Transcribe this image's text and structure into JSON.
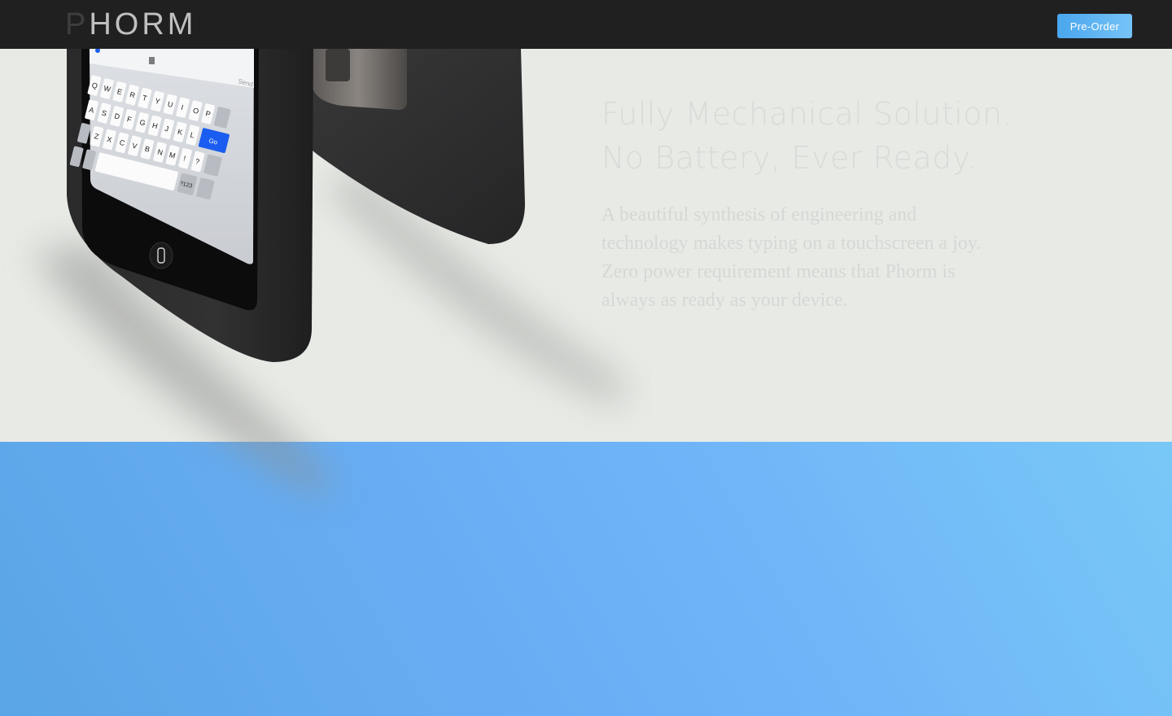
{
  "nav": {
    "logo_first": "P",
    "logo_rest": "HORM",
    "preorder_label": "Pre-Order"
  },
  "hero": {
    "headline_line1": "Fully Mechanical Solution.",
    "headline_line2": "No Battery, Ever Ready.",
    "body": "A beautiful synthesis of engineering and technology makes typing on a touchscreen a joy. Zero power requirement means that Phorm is always as ready as your device."
  },
  "keyboard": {
    "row1": [
      "Q",
      "W",
      "E",
      "R",
      "T",
      "Y",
      "U",
      "I",
      "O",
      "P"
    ],
    "row2": [
      "A",
      "S",
      "D",
      "F",
      "G",
      "H",
      "J",
      "K",
      "L"
    ],
    "row3": [
      "Z",
      "X",
      "C",
      "V",
      "B",
      "N",
      "M",
      "!",
      "?"
    ],
    "send_label": "Send",
    "go_label": "Go",
    "numbers_label": "?123"
  },
  "colors": {
    "nav_bg": "#212021",
    "hero_bg": "#e8eae6",
    "accent_blue": "#4aa6ee",
    "go_key": "#1b5df0"
  }
}
